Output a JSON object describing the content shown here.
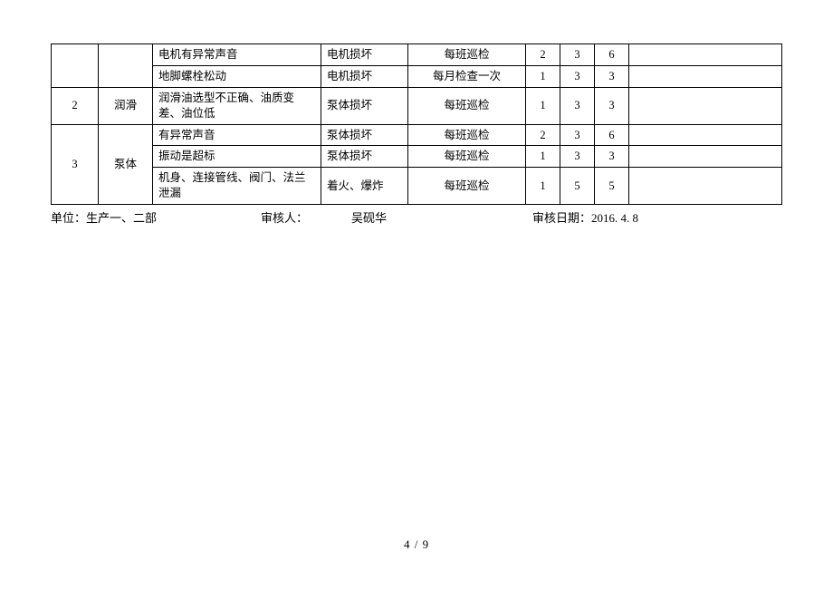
{
  "rows": [
    {
      "idx": "",
      "cat": "",
      "desc": "电机有异常声音",
      "fail": "电机损坏",
      "freq": "每班巡检",
      "a": "2",
      "b": "3",
      "c": "6",
      "note": ""
    },
    {
      "idx": "",
      "cat": "",
      "desc": "地脚螺栓松动",
      "fail": "电机损坏",
      "freq": "每月检查一次",
      "a": "1",
      "b": "3",
      "c": "3",
      "note": ""
    },
    {
      "idx": "2",
      "cat": "润滑",
      "desc": "润滑油选型不正确、油质变差、油位低",
      "fail": "泵体损坏",
      "freq": "每班巡检",
      "a": "1",
      "b": "3",
      "c": "3",
      "note": ""
    },
    {
      "idx": "",
      "cat": "",
      "desc": "有异常声音",
      "fail": "泵体损坏",
      "freq": "每班巡检",
      "a": "2",
      "b": "3",
      "c": "6",
      "note": ""
    },
    {
      "idx": "",
      "cat": "",
      "desc": "振动是超标",
      "fail": "泵体损坏",
      "freq": "每班巡检",
      "a": "1",
      "b": "3",
      "c": "3",
      "note": ""
    },
    {
      "idx": "",
      "cat": "",
      "desc": "机身、连接管线、阀门、法兰泄漏",
      "fail": "着火、爆炸",
      "freq": "每班巡检",
      "a": "1",
      "b": "5",
      "c": "5",
      "note": ""
    }
  ],
  "group3": {
    "idx": "3",
    "cat": "泵体"
  },
  "footer": {
    "unit": "单位：生产一、二部",
    "reviewer_label": "审核人：",
    "reviewer_name": "吴砚华",
    "date_label": "审核日期：",
    "date_value": "2016. 4. 8"
  },
  "page": {
    "current": "4",
    "sep": " / ",
    "total": "9"
  }
}
